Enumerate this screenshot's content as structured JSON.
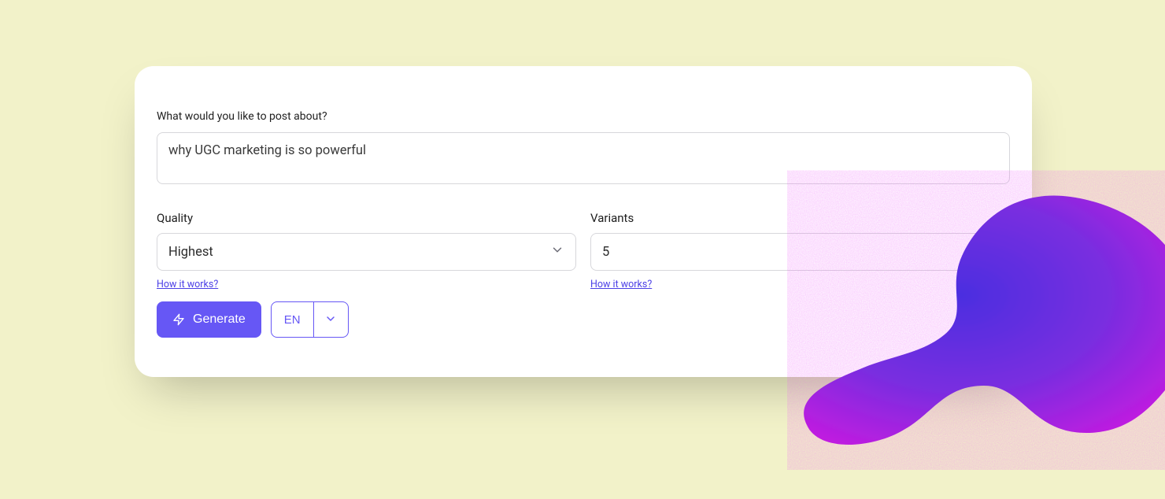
{
  "prompt": {
    "label": "What would you like to post about?",
    "value": "why UGC marketing is so powerful"
  },
  "quality": {
    "label": "Quality",
    "value": "Highest",
    "help": "How it works?"
  },
  "variants": {
    "label": "Variants",
    "value": "5",
    "help": "How it works?"
  },
  "actions": {
    "generate": "Generate",
    "language": "EN"
  },
  "colors": {
    "accent": "#6657f5",
    "background": "#f2f2c9"
  }
}
